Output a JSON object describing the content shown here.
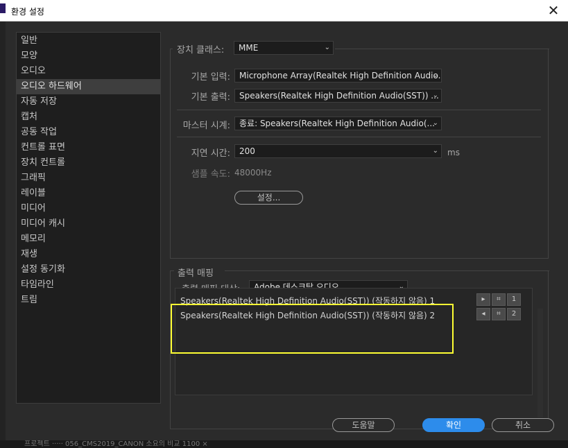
{
  "window": {
    "title": "환경 설정",
    "close_icon": "close-icon"
  },
  "sidebar": {
    "items": [
      "일반",
      "모양",
      "오디오",
      "오디오 하드웨어",
      "자동 저장",
      "캡처",
      "공동 작업",
      "컨트롤 표면",
      "장치 컨트롤",
      "그래픽",
      "레이블",
      "미디어",
      "미디어 캐시",
      "메모리",
      "재생",
      "설정 동기화",
      "타임라인",
      "트림"
    ],
    "selected": "오디오 하드웨어"
  },
  "device": {
    "class_label": "장치 클래스:",
    "class_value": "MME",
    "input_label": "기본 입력:",
    "input_value": "Microphone Array(Realtek High Definition Audio...",
    "output_label": "기본 출력:",
    "output_value": "Speakers(Realtek High Definition Audio(SST)) ...",
    "master_label": "마스터 시계:",
    "master_value": "종료: Speakers(Realtek High Definition Audio(...",
    "latency_label": "지연 시간:",
    "latency_value": "200",
    "latency_unit": "ms",
    "sample_label": "샘플 속도:",
    "sample_value": "48000Hz",
    "settings_button": "설정..."
  },
  "mapping": {
    "section_label": "출력 매핑",
    "target_label": "출력 매핑 대상:",
    "target_value": "Adobe 데스크탑 오디오",
    "rows": [
      {
        "text": "Speakers(Realtek High Definition Audio(SST)) (작동하지 않음) 1",
        "channel": "1"
      },
      {
        "text": "Speakers(Realtek High Definition Audio(SST)) (작동하지 않음) 2",
        "channel": "2"
      }
    ]
  },
  "footer": {
    "help": "도움말",
    "ok": "확인",
    "cancel": "취소"
  },
  "background_strip": "프로젝트 ····· 056_CMS2019_CANON  소요의 비교 1100  ×",
  "colors": {
    "accent": "#2d8ceb",
    "highlight": "#ffff33"
  }
}
